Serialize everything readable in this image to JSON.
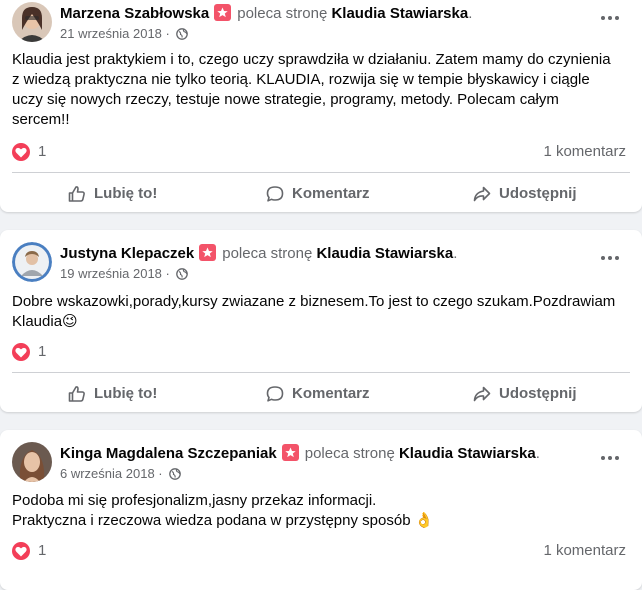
{
  "common": {
    "recommends_text": "poleca stronę",
    "page_name": "Klaudia Stawiarska",
    "like_label": "Lubię to!",
    "comment_label": "Komentarz",
    "share_label": "Udostępnij"
  },
  "posts": [
    {
      "author": "Marzena Szabłowska",
      "date": "21 września 2018",
      "text_lines": [
        "Klaudia jest praktykiem i to, czego uczy sprawdziła w działaniu. Zatem mamy do czynienia",
        "z wiedzą praktyczna nie tylko teorią. KLAUDIA, rozwija się w tempie błyskawicy i ciągle",
        "uczy się nowych rzeczy, testuje nowe strategie, programy, metody. Polecam całym",
        "sercem!!"
      ],
      "reactions": "1",
      "comments": "1 komentarz"
    },
    {
      "author": "Justyna Klepaczek",
      "date": "19 września 2018",
      "text_lines": [
        "Dobre wskazowki,porady,kursy zwiazane z biznesem.To jest to czego szukam.Pozdrawiam",
        "Klaudia😉"
      ],
      "reactions": "1",
      "comments": ""
    },
    {
      "author": "Kinga Magdalena Szczepaniak",
      "date": "6 września 2018",
      "text_lines": [
        "Podoba mi się profesjonalizm,jasny przekaz informacji.",
        "Praktyczna i rzeczowa wiedza podana w przystępny sposób 👌"
      ],
      "reactions": "1",
      "comments": "1 komentarz"
    }
  ],
  "colors": {
    "recommend_badge": "#f35369",
    "love_reaction": "#f33e58",
    "muted_text": "#65676b"
  },
  "icons": [
    "globe-icon",
    "more-icon",
    "recommend-star-icon",
    "heart-icon",
    "like-icon",
    "comment-icon",
    "share-icon"
  ]
}
